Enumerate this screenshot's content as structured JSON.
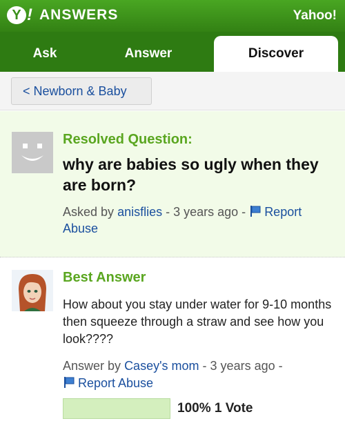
{
  "header": {
    "logo_badge": "Y",
    "logo_excl": "!",
    "logo_text": "ANSWERS",
    "yahoo_link": "Yahoo!"
  },
  "tabs": [
    {
      "label": "Ask",
      "active": false
    },
    {
      "label": "Answer",
      "active": false
    },
    {
      "label": "Discover",
      "active": true
    }
  ],
  "breadcrumb": {
    "label": "< Newborn & Baby"
  },
  "question": {
    "status_label": "Resolved Question:",
    "title": "why are babies so ugly when they are born?",
    "asked_prefix": "Asked by",
    "asker": "anisflies",
    "time": "- 3 years ago -",
    "report_label": "Report Abuse",
    "avatar_icon": "default-avatar-icon"
  },
  "best_answer": {
    "label": "Best Answer",
    "body": "How about you stay under water for 9-10 months then squeeze through a straw and see how you look????",
    "answer_prefix": "Answer by",
    "author": "Casey's mom",
    "time": "- 3 years ago -",
    "report_label": "Report Abuse",
    "avatar_icon": "user-avatar-icon",
    "vote_fraction": 1.0,
    "vote_summary": "100% 1 Vote"
  },
  "colors": {
    "brand_green": "#3a8f1b",
    "label_green": "#5aa620",
    "link_blue": "#1a4f9e",
    "question_bg": "#f2fbe8"
  }
}
